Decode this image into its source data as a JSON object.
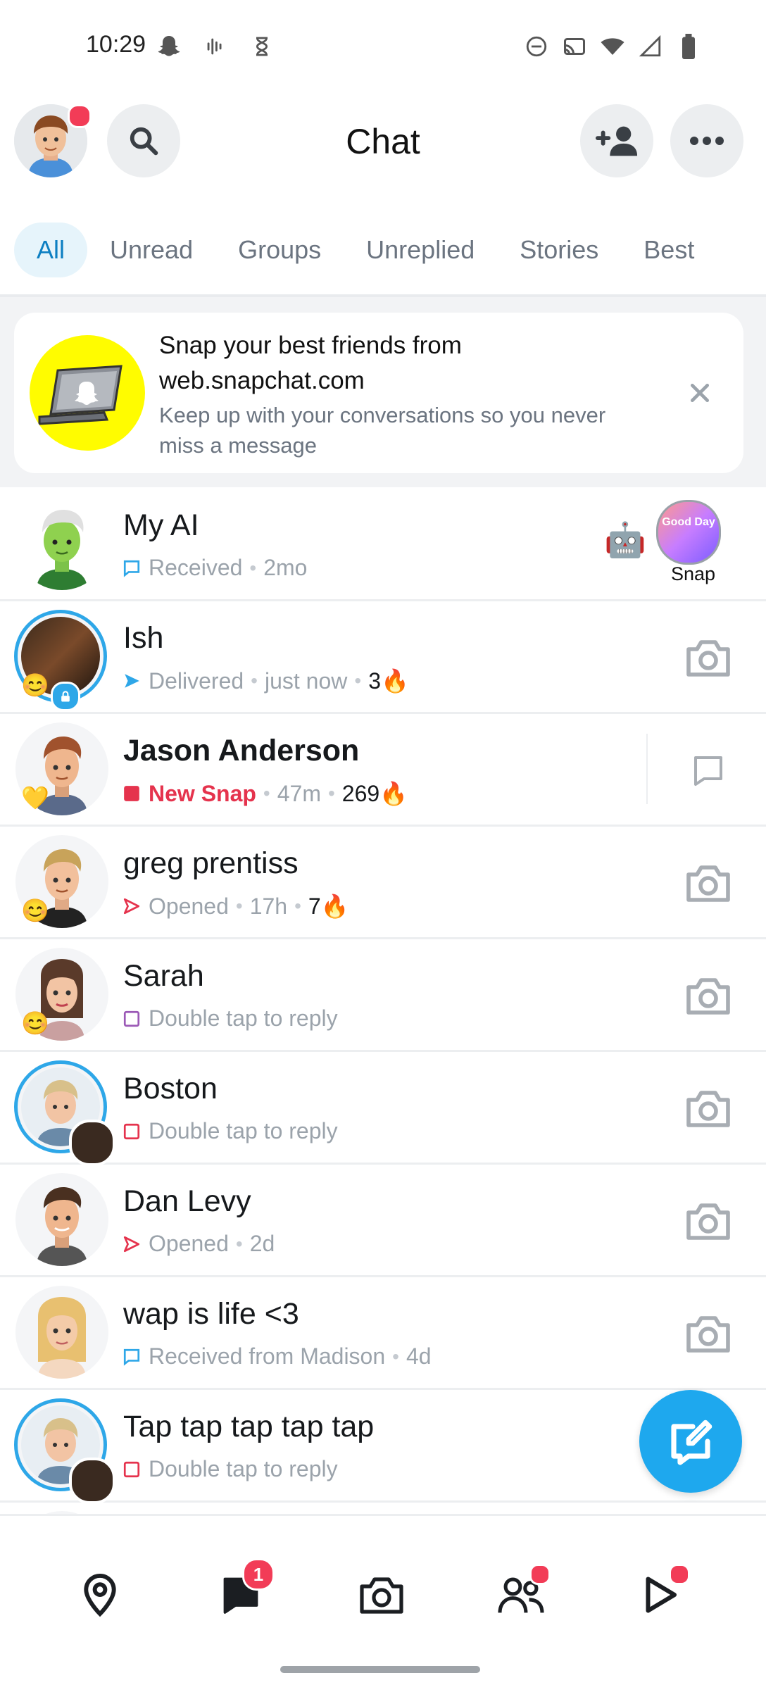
{
  "status_bar": {
    "time": "10:29",
    "left_icons": [
      "snapchat-ghost-icon",
      "voice-icon",
      "hourglass-icon"
    ],
    "right_icons": [
      "dnd-icon",
      "cast-icon",
      "wifi-icon",
      "signal-icon",
      "battery-icon"
    ]
  },
  "header": {
    "title": "Chat",
    "has_notification_dot": true
  },
  "tabs": [
    "All",
    "Unread",
    "Groups",
    "Unreplied",
    "Stories",
    "Best"
  ],
  "active_tab": "All",
  "banner": {
    "title": "Snap your best friends from web.snapchat.com",
    "subtitle": "Keep up with your conversations so you never miss a message"
  },
  "chats": [
    {
      "name": "My AI",
      "status": "Received",
      "time": "2mo",
      "status_color": "#2ea7e8",
      "status_icon": "chat-square-icon",
      "right": "snap",
      "snap_label": "Snap",
      "snap_thumb_text": "Good Day"
    },
    {
      "name": "Ish",
      "status": "Delivered",
      "time": "just now",
      "streak": "3🔥",
      "status_color": "#2ea7e8",
      "status_icon": "send-filled-icon",
      "right": "camera"
    },
    {
      "name": "Jason Anderson",
      "status": "New Snap",
      "time": "47m",
      "streak": "269🔥",
      "status_color": "#e5334d",
      "status_icon": "snap-filled-icon",
      "right": "chat"
    },
    {
      "name": "greg prentiss",
      "status": "Opened",
      "time": "17h",
      "streak": "7🔥",
      "status_color": "#e5334d",
      "status_icon": "send-outline-icon",
      "right": "camera"
    },
    {
      "name": "Sarah",
      "status": "Double tap to reply",
      "status_color": "#9b59b6",
      "status_icon": "square-outline-icon",
      "right": "camera"
    },
    {
      "name": "Boston",
      "status": "Double tap to reply",
      "status_color": "#e5334d",
      "status_icon": "square-outline-icon",
      "right": "camera"
    },
    {
      "name": "Dan Levy",
      "status": "Opened",
      "time": "2d",
      "status_color": "#e5334d",
      "status_icon": "send-outline-icon",
      "right": "camera"
    },
    {
      "name": "wap is life <3",
      "status": "Received from Madison",
      "time": "4d",
      "status_color": "#2ea7e8",
      "status_icon": "chat-square-icon",
      "right": "camera"
    },
    {
      "name": "Tap tap tap tap tap",
      "status": "Double tap to reply",
      "status_color": "#e5334d",
      "status_icon": "square-outline-icon",
      "right": "none"
    }
  ],
  "bottom_nav": {
    "items": [
      "map-pin-icon",
      "chat-icon",
      "camera-icon",
      "friends-icon",
      "stories-play-icon"
    ],
    "chat_badge": "1"
  }
}
